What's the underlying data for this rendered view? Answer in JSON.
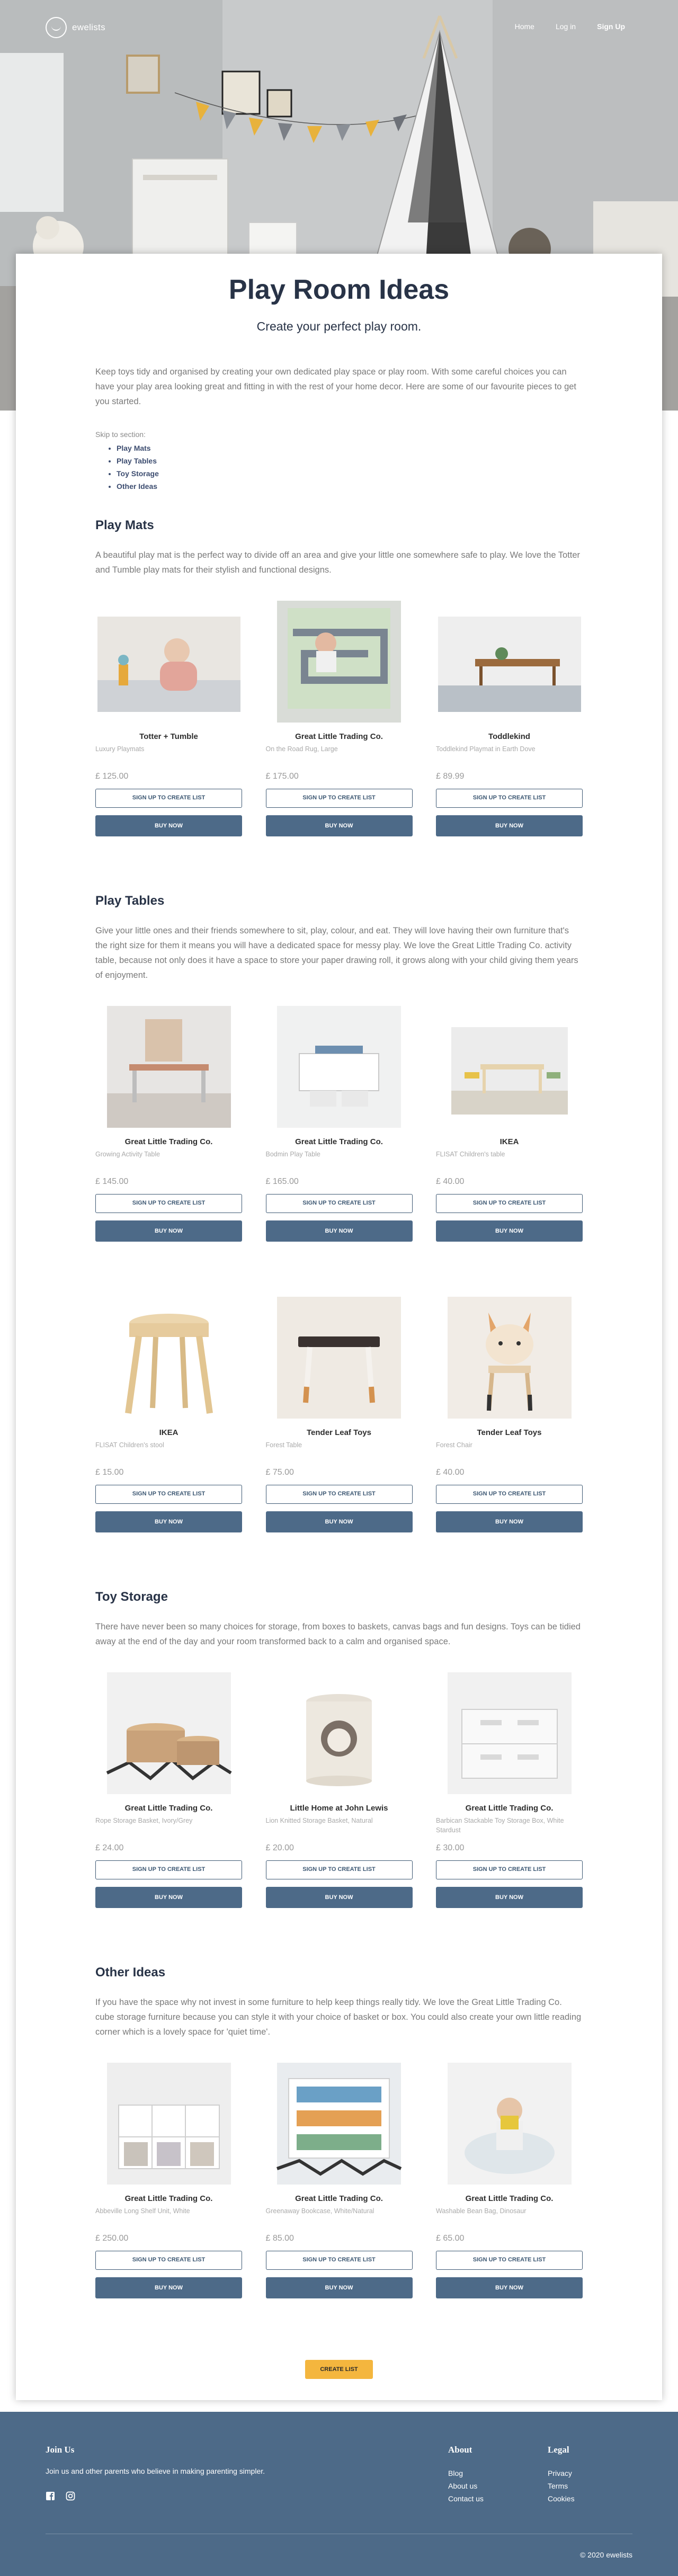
{
  "nav": {
    "logo_text": "ewelists",
    "links": [
      "Home",
      "Log in",
      "Sign Up"
    ]
  },
  "page": {
    "title": "Play Room Ideas",
    "subtitle": "Create your perfect play room.",
    "intro": "Keep toys tidy and organised by creating your own dedicated play space or play room. With some careful choices you can have your play area looking great and fitting in with the rest of your home decor. Here are some of our favourite pieces to get you started.",
    "skip_label": "Skip to section:",
    "skip_links": [
      "Play Mats",
      "Play Tables",
      "Toy Storage",
      "Other Ideas"
    ]
  },
  "buttons": {
    "signup_create": "SIGN UP TO CREATE LIST",
    "buy_now": "BUY NOW",
    "create_list": "CREATE LIST"
  },
  "sections": [
    {
      "title": "Play Mats",
      "text": "A beautiful play mat is the perfect way to divide off an area and give your little one somewhere safe to play. We love the Totter and Tumble play mats for their stylish and functional designs.",
      "rows": [
        [
          {
            "brand": "Totter + Tumble",
            "name": "Luxury Playmats",
            "price": "£ 125.00",
            "icon": "playmat-baby-image"
          },
          {
            "brand": "Great Little Trading Co.",
            "name": "On the Road Rug, Large",
            "price": "£ 175.00",
            "icon": "road-rug-image"
          },
          {
            "brand": "Toddlekind",
            "name": "Toddlekind Playmat in Earth Dove",
            "price": "£ 89.99",
            "icon": "playmat-room-image"
          }
        ]
      ]
    },
    {
      "title": "Play Tables",
      "text": "Give your little ones and their friends somewhere to sit, play, colour, and eat. They will love having their own furniture that's the right size for them it means you will have a dedicated space for messy play. We love the Great Little Trading Co. activity table, because not only does it have a space to store your paper drawing roll, it grows along with your child giving them years of enjoyment.",
      "rows": [
        [
          {
            "brand": "Great Little Trading Co.",
            "name": "Growing Activity Table",
            "price": "£ 145.00",
            "icon": "activity-table-image"
          },
          {
            "brand": "Great Little Trading Co.",
            "name": "Bodmin Play Table",
            "price": "£ 165.00",
            "icon": "play-table-image"
          },
          {
            "brand": "IKEA",
            "name": "FLISAT Children's table",
            "price": "£ 40.00",
            "icon": "flisat-table-image"
          }
        ],
        [
          {
            "brand": "IKEA",
            "name": "FLISAT Children's stool",
            "price": "£ 15.00",
            "icon": "stool-image"
          },
          {
            "brand": "Tender Leaf Toys",
            "name": "Forest Table",
            "price": "£ 75.00",
            "icon": "forest-table-image"
          },
          {
            "brand": "Tender Leaf Toys",
            "name": "Forest Chair",
            "price": "£ 40.00",
            "icon": "fox-chair-image"
          }
        ]
      ]
    },
    {
      "title": "Toy Storage",
      "text": "There have never been so many choices for storage, from boxes to baskets, canvas bags and fun designs. Toys can be tidied away at the end of the day and your room transformed back to a calm and organised space.",
      "rows": [
        [
          {
            "brand": "Great Little Trading Co.",
            "name": "Rope Storage Basket, Ivory/Grey",
            "price": "£ 24.00",
            "icon": "rope-basket-image"
          },
          {
            "brand": "Little Home at John Lewis",
            "name": "Lion Knitted Storage Basket, Natural",
            "price": "£ 20.00",
            "icon": "lion-basket-image"
          },
          {
            "brand": "Great Little Trading Co.",
            "name": "Barbican Stackable Toy Storage Box, White Stardust",
            "price": "£ 30.00",
            "icon": "storage-box-image"
          }
        ]
      ]
    },
    {
      "title": "Other Ideas",
      "text": "If you have the space why not invest in some furniture to help keep things really tidy. We love the Great Little Trading Co. cube storage furniture because you can style it with your choice of basket or box. You could also create your own little reading corner which is a lovely space for 'quiet time'.",
      "rows": [
        [
          {
            "brand": "Great Little Trading Co.",
            "name": "Abbeville Long Shelf Unit, White",
            "price": "£ 250.00",
            "icon": "shelf-unit-image"
          },
          {
            "brand": "Great Little Trading Co.",
            "name": "Greenaway Bookcase, White/Natural",
            "price": "£ 85.00",
            "icon": "bookcase-image"
          },
          {
            "brand": "Great Little Trading Co.",
            "name": "Washable Bean Bag, Dinosaur",
            "price": "£ 65.00",
            "icon": "bean-bag-image"
          }
        ]
      ]
    }
  ],
  "footer": {
    "join_title": "Join Us",
    "join_text": "Join us and other parents who believe in making parenting simpler.",
    "about_title": "About",
    "about_links": [
      "Blog",
      "About us",
      "Contact us"
    ],
    "legal_title": "Legal",
    "legal_links": [
      "Privacy",
      "Terms",
      "Cookies"
    ],
    "copyright": "© 2020 ewelists",
    "social": [
      "facebook-icon",
      "instagram-icon"
    ]
  },
  "colors": {
    "primary": "#4d6a88",
    "title": "#283347",
    "accent": "#f4b63e"
  }
}
